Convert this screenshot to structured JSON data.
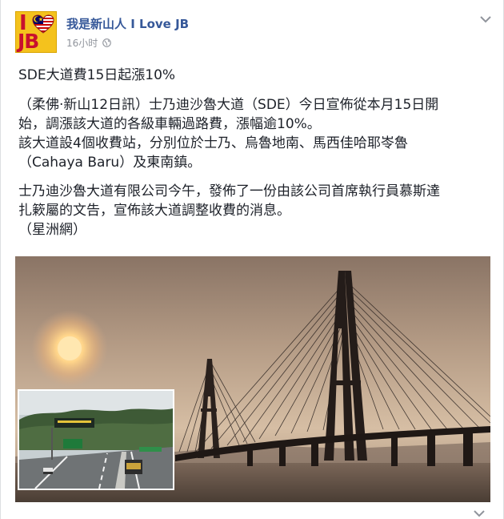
{
  "post": {
    "page_name": "我是新山人 I Love JB",
    "timestamp": "16小时",
    "avatar": {
      "letter_i": "I",
      "letters_jb": "JB"
    },
    "title": "SDE大道費15日起漲10%",
    "paragraphs": [
      "（柔佛‧新山12日訊）士乃迪沙魯大道（SDE）今日宣佈從本月15日開",
      "始，調漲該大道的各級車輛過路費，漲幅逾10%。",
      "該大道設4個收費站，分別位於士乃、烏魯地南、馬西佳哈耶岺魯",
      "（Cahaya Baru）及東南鎮。",
      "士乃迪沙魯大道有限公司今午，發佈了一份由該公司首席執行員慕斯達",
      "扎簌屬的文告，宣佈該大道調整收費的消息。",
      "（星洲網）"
    ]
  },
  "colors": {
    "page_name": "#365899",
    "timestamp": "#90949c",
    "text": "#1d2129",
    "avatar_bg": "#f4c21d",
    "avatar_letters": "#c8102e"
  },
  "icons": {
    "privacy": "globe-icon",
    "menu": "chevron-down-icon"
  }
}
